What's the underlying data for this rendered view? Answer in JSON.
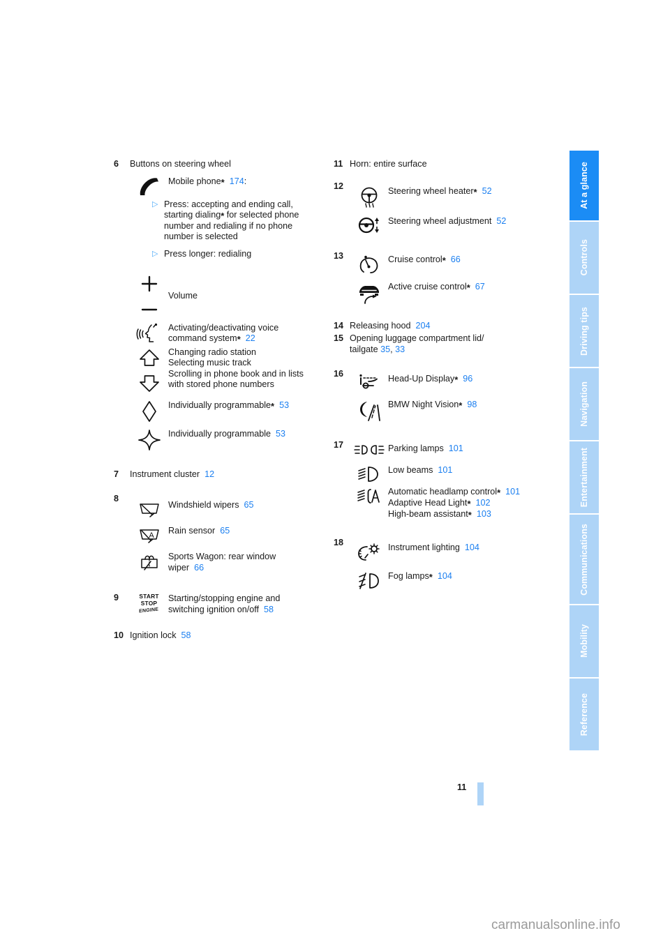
{
  "document": {
    "page_number": "11",
    "watermark": "carmanualsonline.info"
  },
  "tabs": [
    {
      "label": "At a glance",
      "active": true
    },
    {
      "label": "Controls",
      "active": false
    },
    {
      "label": "Driving tips",
      "active": false
    },
    {
      "label": "Navigation",
      "active": false
    },
    {
      "label": "Entertainment",
      "active": false
    },
    {
      "label": "Communications",
      "active": false
    },
    {
      "label": "Mobility",
      "active": false
    },
    {
      "label": "Reference",
      "active": false
    }
  ],
  "colors": {
    "accent_active": "#1b8cf5",
    "accent_light": "#aed4f7",
    "page_ref": "#1b7ff0",
    "bullet": "#4aa8f7"
  },
  "left_column": {
    "item6": {
      "number": "6",
      "title": "Buttons on steering wheel",
      "phone": {
        "icon": "phone-handset-icon",
        "label": "Mobile phone",
        "asterisk": "*",
        "page": "174",
        "suffix": ":",
        "bullets": [
          "Press: accepting and ending call, starting dialing",
          "Press longer: redialing"
        ],
        "bullet1_asterisk": "*",
        "bullet1_tail": " for selected phone number and redialing if no phone number is selected"
      },
      "volume": {
        "plus_icon": "plus-icon",
        "minus_icon": "minus-icon",
        "label": "Volume"
      },
      "voice": {
        "icon": "voice-command-icon",
        "label_line1": "Activating/deactivating voice",
        "label_line2": "command system",
        "asterisk": "*",
        "page": "22"
      },
      "scroll": {
        "up_icon": "arrow-up-icon",
        "down_icon": "arrow-down-icon",
        "lines": [
          "Changing radio station",
          "Selecting music track",
          "Scrolling in phone book and in lists",
          "with stored phone numbers"
        ]
      },
      "prog_star": {
        "icon": "diamond-icon",
        "label": "Individually programmable",
        "asterisk": "*",
        "page": "53"
      },
      "prog_plain": {
        "icon": "four-point-star-icon",
        "label": "Individually programmable",
        "page": "53"
      }
    },
    "item7": {
      "number": "7",
      "label": "Instrument cluster",
      "page": "12"
    },
    "item8": {
      "number": "8",
      "rows": [
        {
          "icon": "windshield-wiper-icon",
          "label": "Windshield wipers",
          "page": "65"
        },
        {
          "icon": "rain-sensor-icon",
          "label": "Rain sensor",
          "page": "65"
        },
        {
          "icon": "rear-window-wiper-icon",
          "label_line1": "Sports Wagon: rear window",
          "label_line2": "wiper",
          "page": "66"
        }
      ]
    },
    "item9": {
      "number": "9",
      "icon": "start-stop-engine-icon",
      "icon_text": {
        "line1": "START",
        "line2": "STOP",
        "line3": "ENGINE"
      },
      "label_line1": "Starting/stopping engine and",
      "label_line2": "switching ignition on/off",
      "page": "58"
    },
    "item10": {
      "number": "10",
      "label": "Ignition lock",
      "page": "58"
    }
  },
  "right_column": {
    "item11": {
      "number": "11",
      "label": "Horn: entire surface"
    },
    "item12": {
      "number": "12",
      "rows": [
        {
          "icon": "steering-wheel-heater-icon",
          "label": "Steering wheel heater",
          "asterisk": "*",
          "page": "52"
        },
        {
          "icon": "steering-wheel-adjustment-icon",
          "label": "Steering wheel adjustment",
          "page": "52"
        }
      ]
    },
    "item13": {
      "number": "13",
      "rows": [
        {
          "icon": "cruise-control-icon",
          "label": "Cruise control",
          "asterisk": "*",
          "page": "66"
        },
        {
          "icon": "active-cruise-control-icon",
          "label": "Active cruise control",
          "asterisk": "*",
          "page": "67"
        }
      ]
    },
    "item14": {
      "number": "14",
      "label": "Releasing hood",
      "page": "204"
    },
    "item15": {
      "number": "15",
      "label_line1": "Opening luggage compartment lid/",
      "label_line2": "tailgate",
      "page1": "35",
      "separator": ",",
      "page2": "33"
    },
    "item16": {
      "number": "16",
      "rows": [
        {
          "icon": "head-up-display-icon",
          "label": "Head-Up Display",
          "asterisk": "*",
          "page": "96"
        },
        {
          "icon": "night-vision-icon",
          "label": "BMW Night Vision",
          "asterisk": "*",
          "page": "98"
        }
      ]
    },
    "item17": {
      "number": "17",
      "parking": {
        "icon": "parking-lamps-icon",
        "label": "Parking lamps",
        "page": "101"
      },
      "low": {
        "icon": "low-beams-icon",
        "label": "Low beams",
        "page": "101"
      },
      "auto": {
        "icon": "automatic-headlamp-icon",
        "line1": {
          "label": "Automatic headlamp control",
          "asterisk": "*",
          "page": "101"
        },
        "line2": {
          "label": "Adaptive Head Light",
          "asterisk": "*",
          "page": "102"
        },
        "line3": {
          "label": "High-beam assistant",
          "asterisk": "*",
          "page": "103"
        }
      }
    },
    "item18": {
      "number": "18",
      "rows": [
        {
          "icon": "instrument-lighting-icon",
          "label": "Instrument lighting",
          "page": "104"
        },
        {
          "icon": "fog-lamps-icon",
          "label": "Fog lamps",
          "asterisk": "*",
          "page": "104"
        }
      ]
    }
  }
}
